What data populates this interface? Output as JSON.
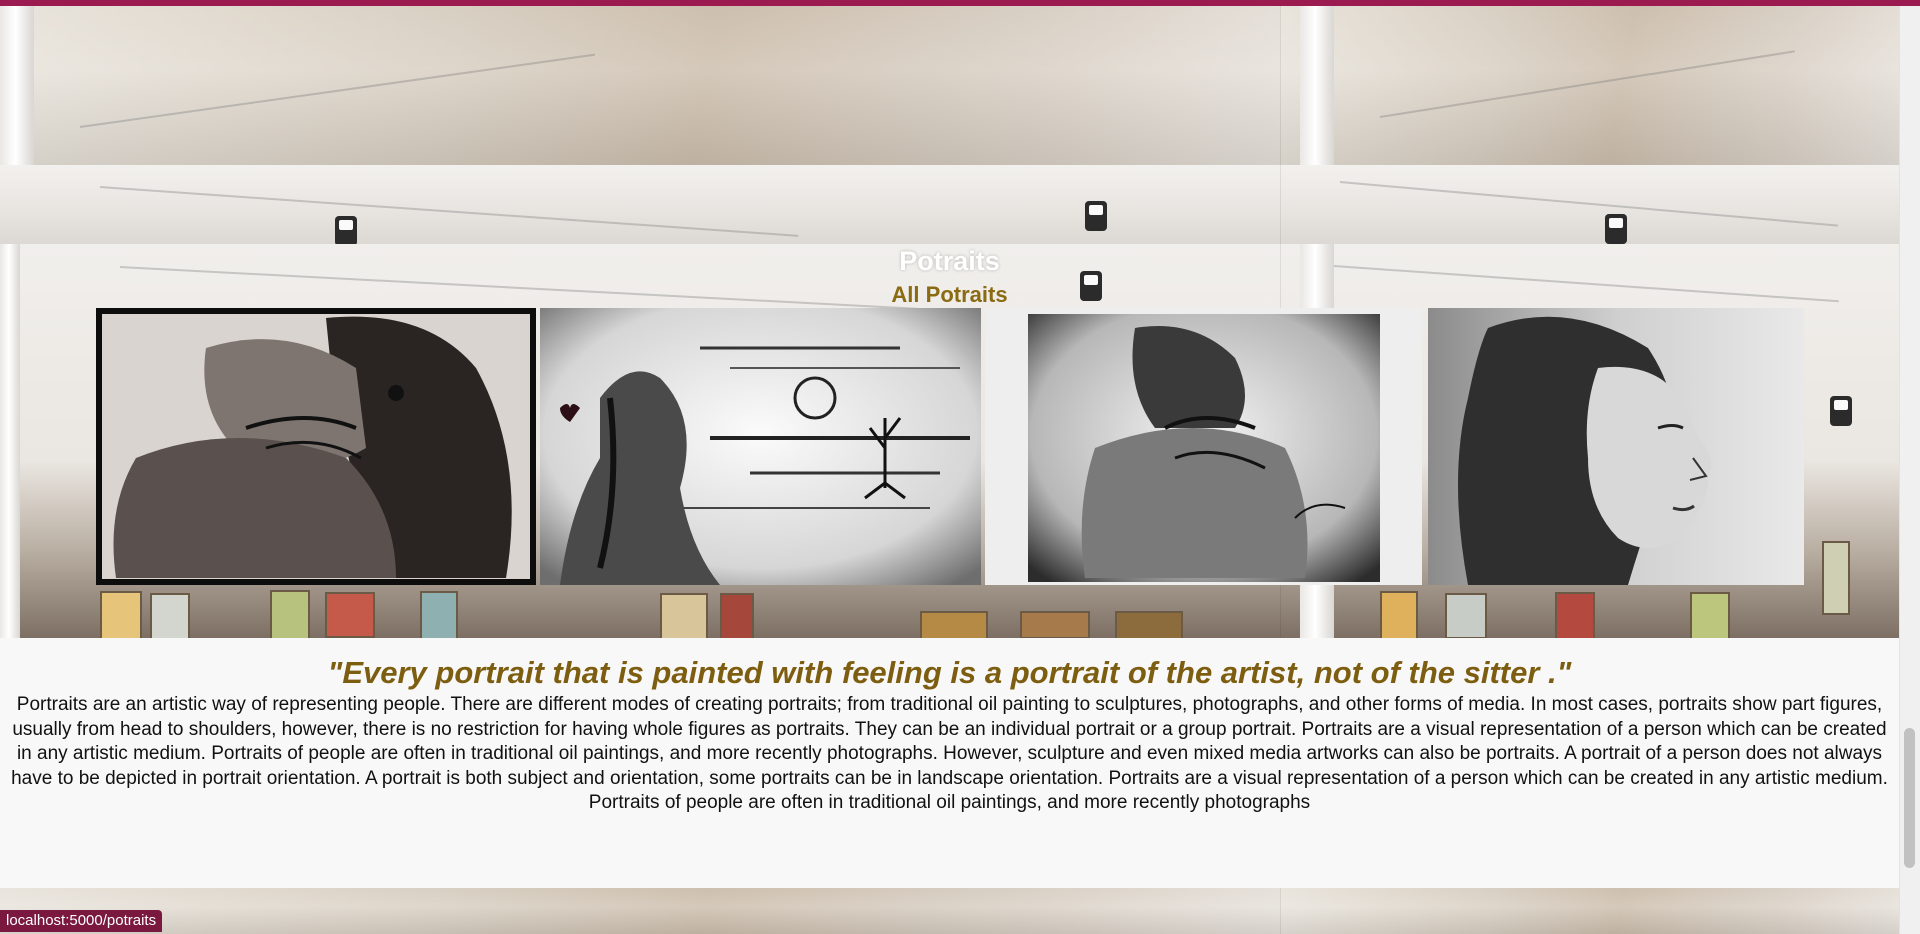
{
  "page": {
    "title": "Potraits",
    "subtitle": "All Potraits"
  },
  "gallery": {
    "items": [
      {
        "name": "Couple embrace sketch 1"
      },
      {
        "name": "Couple at sunset sketch"
      },
      {
        "name": "Couple embrace sketch 2"
      },
      {
        "name": "Woman profile portrait"
      }
    ]
  },
  "content": {
    "quote": "\"Every portrait that is painted with feeling is a portrait of the artist, not of the sitter .\"",
    "description": "Portraits are an artistic way of representing people. There are different modes of creating portraits; from traditional oil painting to sculptures, photographs, and other forms of media. In most cases, portraits show part figures, usually from head to shoulders, however, there is no restriction for having whole figures as portraits. They can be an individual portrait or a group portrait. Portraits are a visual representation of a person which can be created in any artistic medium. Portraits of people are often in traditional oil paintings, and more recently photographs. However, sculpture and even mixed media artworks can also be portraits. A portrait of a person does not always have to be depicted in portrait orientation. A portrait is both subject and orientation, some portraits can be in landscape orientation. Portraits are a visual representation of a person which can be created in any artistic medium. Portraits of people are often in traditional oil paintings, and more recently photographs"
  },
  "status_bar": {
    "url": "localhost:5000/potraits"
  },
  "colors": {
    "accent_bar": "#9b1a4f",
    "subtitle": "#8a6a12",
    "quote": "#7d5e10",
    "status_bg": "#7a1840"
  }
}
